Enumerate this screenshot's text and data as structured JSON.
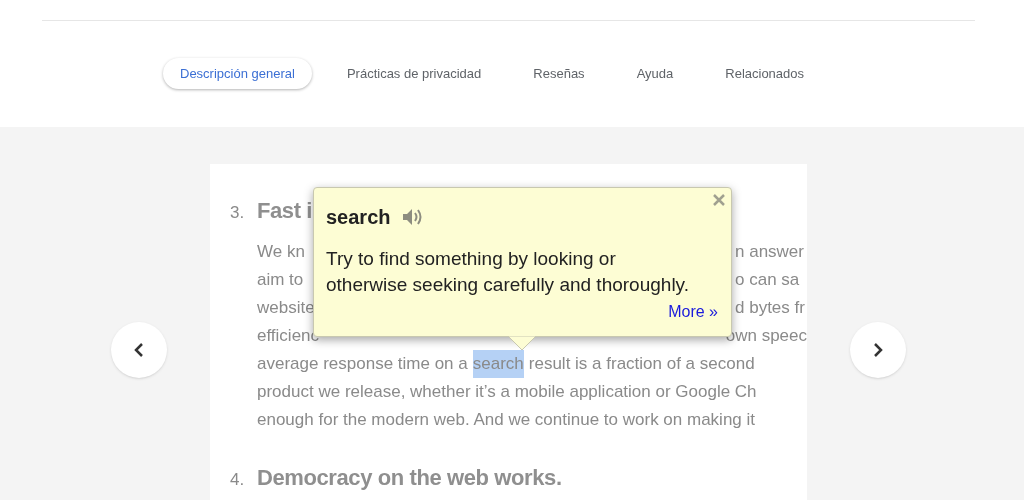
{
  "tabs": [
    {
      "label": "Descripción general",
      "selected": true
    },
    {
      "label": "Prácticas de privacidad",
      "selected": false
    },
    {
      "label": "Reseñas",
      "selected": false
    },
    {
      "label": "Ayuda",
      "selected": false
    },
    {
      "label": "Relacionados",
      "selected": false
    }
  ],
  "slide": {
    "item_3": {
      "number": "3.",
      "heading": "Fast i"
    },
    "covered_lines": [
      {
        "left": "We kn",
        "right": "n answer"
      },
      {
        "left": "aim to",
        "right": "o can sa"
      },
      {
        "left": "website",
        "right": "d bytes fr"
      },
      {
        "left": "efficienc",
        "right": "own speec"
      }
    ],
    "lines": [
      {
        "parts": [
          {
            "text": "average response time on a",
            "selected": false
          },
          {
            "text": "search",
            "selected": true
          },
          {
            "text": "result is a fraction of a second",
            "selected": false
          }
        ]
      },
      {
        "parts": [
          {
            "text": "product we release, whether it’s a mobile application or Google Ch",
            "selected": false
          }
        ]
      },
      {
        "parts": [
          {
            "text": "enough for the modern web. And we continue to work on making it",
            "selected": false
          }
        ]
      }
    ],
    "item_4": {
      "number": "4.",
      "heading": "Democracy on the web works."
    }
  },
  "popup": {
    "word": "search",
    "definition": "Try to find something by looking or otherwise seeking carefully and thoroughly.",
    "more_link": "More »"
  }
}
